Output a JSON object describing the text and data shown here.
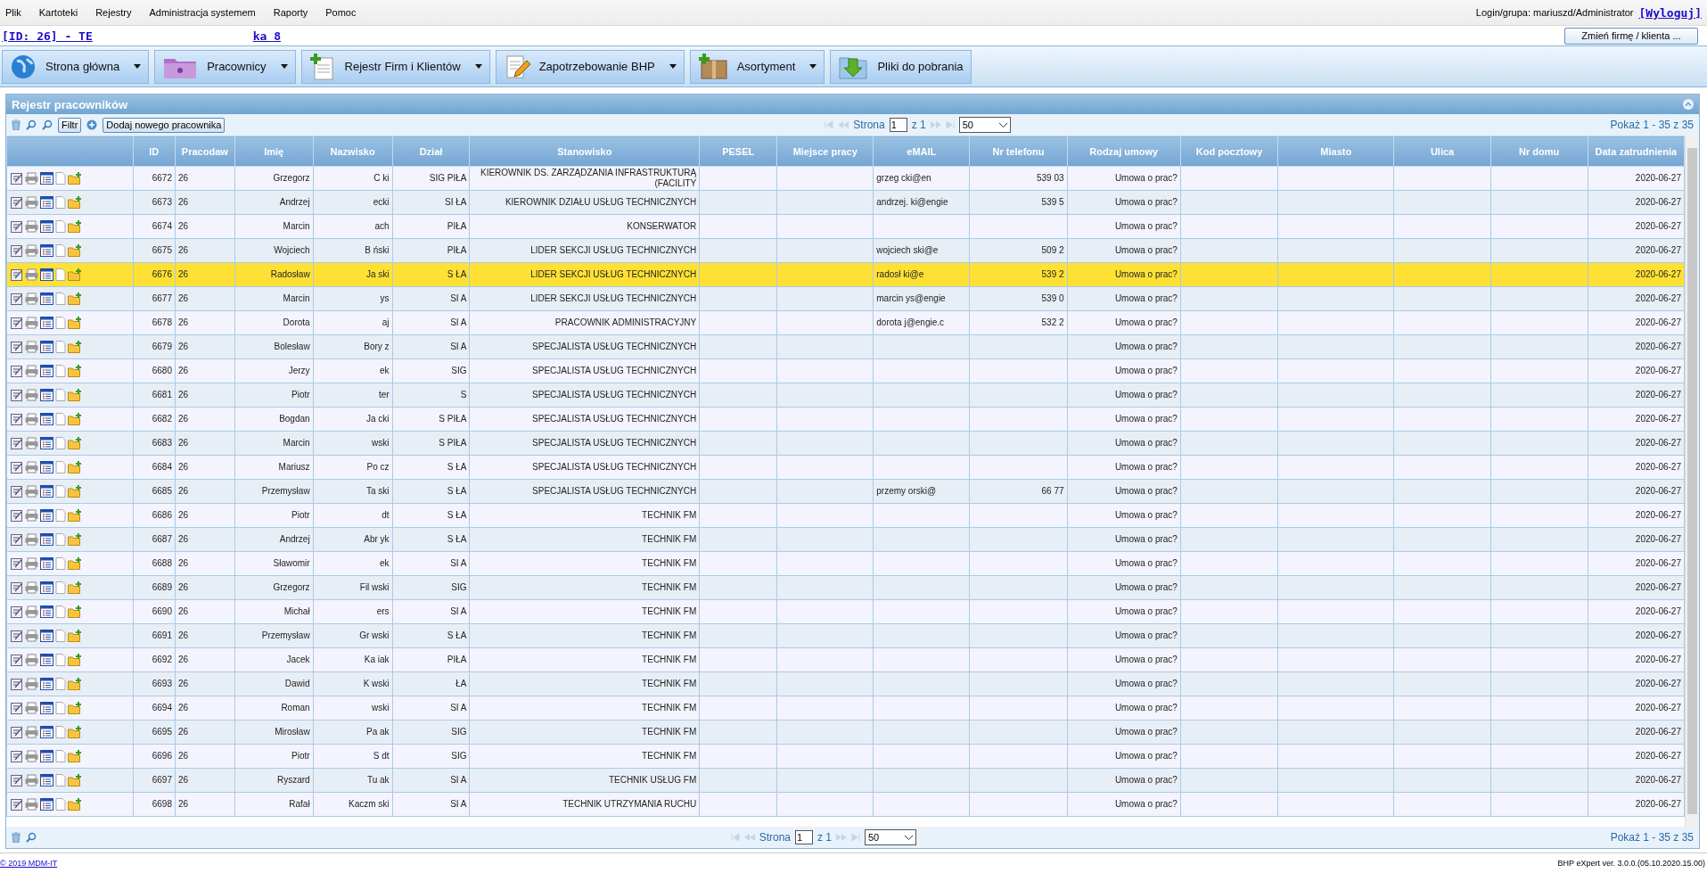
{
  "menu": [
    "Plik",
    "Kartoteki",
    "Rejestry",
    "Administracja systemem",
    "Raporty",
    "Pomoc"
  ],
  "login": {
    "label": "Login/grupa: mariuszd/Administrator",
    "logout": "[Wyloguj]"
  },
  "company_link": {
    "start": "[ID: 26] - TE",
    "end": "ka 8"
  },
  "change_company_button": "Zmień firmę / klienta ...",
  "toolbar": [
    {
      "label": "Strona główna",
      "kind": "globe",
      "has_menu": true
    },
    {
      "label": "Pracownicy",
      "kind": "folder",
      "has_menu": true
    },
    {
      "label": "Rejestr Firm i Klientów",
      "kind": "document",
      "has_menu": true
    },
    {
      "label": "Zapotrzebowanie BHP",
      "kind": "pencil",
      "has_menu": true
    },
    {
      "label": "Asortyment",
      "kind": "box",
      "has_menu": true
    },
    {
      "label": "Pliki do pobrania",
      "kind": "download",
      "has_menu": false
    }
  ],
  "panel": {
    "title": "Rejestr pracowników",
    "filter_button": "Filtr",
    "add_button": "Dodaj nowego pracownika",
    "pager_top": {
      "page_label": "Strona",
      "page": "1",
      "of": "z 1",
      "page_size": "50",
      "summary": "Pokaż 1 - 35 z 35"
    },
    "pager_bottom": {
      "page_label": "Strona",
      "page": "1",
      "of": "z 1",
      "page_size": "50",
      "summary": "Pokaż 1 - 35 z 35"
    }
  },
  "table": {
    "columns": [
      "ID",
      "Pracodaw",
      "Imię",
      "Nazwisko",
      "Dział",
      "Stanowisko",
      "PESEL",
      "Miejsce pracy",
      "eMAIL",
      "Nr telefonu",
      "Rodzaj umowy",
      "Kod pocztowy",
      "Miasto",
      "Ulica",
      "Nr domu",
      "Data zatrudnienia"
    ],
    "rows": [
      {
        "id": "6672",
        "employer": "26",
        "first_name": "Grzegorz",
        "last_name": "C ki",
        "department": "SIG PIŁA",
        "position": "KIEROWNIK DS. ZARZĄDZANIA INFRASTRUKTURĄ (FACILITY",
        "email": "grzeg cki@en",
        "phone": "539 03",
        "contract": "Umowa o prac?",
        "hire_date": "2020-06-27",
        "selected": false
      },
      {
        "id": "6673",
        "employer": "26",
        "first_name": "Andrzej",
        "last_name": "ecki",
        "department": "SI ŁA",
        "position": "KIEROWNIK DZIAŁU USŁUG TECHNICZNYCH",
        "email": "andrzej. ki@engie",
        "phone": "539 5",
        "contract": "Umowa o prac?",
        "hire_date": "2020-06-27",
        "selected": false
      },
      {
        "id": "6674",
        "employer": "26",
        "first_name": "Marcin",
        "last_name": "ach",
        "department": "PIŁA",
        "position": "KONSERWATOR",
        "contract": "Umowa o prac?",
        "hire_date": "2020-06-27",
        "selected": false
      },
      {
        "id": "6675",
        "employer": "26",
        "first_name": "Wojciech",
        "last_name": "B ński",
        "department": "PIŁA",
        "position": "LIDER SEKCJI USŁUG TECHNICZNYCH",
        "email": "wojciech ski@e",
        "phone": "509 2",
        "contract": "Umowa o prac?",
        "hire_date": "2020-06-27",
        "selected": false
      },
      {
        "id": "6676",
        "employer": "26",
        "first_name": "Radosław",
        "last_name": "Ja ski",
        "department": "S ŁA",
        "position": "LIDER SEKCJI USŁUG TECHNICZNYCH",
        "email": "radosł ki@e",
        "phone": "539 2",
        "contract": "Umowa o prac?",
        "hire_date": "2020-06-27",
        "selected": true
      },
      {
        "id": "6677",
        "employer": "26",
        "first_name": "Marcin",
        "last_name": "ys",
        "department": "SI A",
        "position": "LIDER SEKCJI USŁUG TECHNICZNYCH",
        "email": "marcin ys@engie",
        "phone": "539 0",
        "contract": "Umowa o prac?",
        "hire_date": "2020-06-27",
        "selected": false
      },
      {
        "id": "6678",
        "employer": "26",
        "first_name": "Dorota",
        "last_name": "aj",
        "department": "SI A",
        "position": "PRACOWNIK ADMINISTRACYJNY",
        "email": "dorota j@engie.c",
        "phone": "532 2",
        "contract": "Umowa o prac?",
        "hire_date": "2020-06-27",
        "selected": false
      },
      {
        "id": "6679",
        "employer": "26",
        "first_name": "Bolesław",
        "last_name": "Bory z",
        "department": "SI A",
        "position": "SPECJALISTA USŁUG TECHNICZNYCH",
        "contract": "Umowa o prac?",
        "hire_date": "2020-06-27",
        "selected": false
      },
      {
        "id": "6680",
        "employer": "26",
        "first_name": "Jerzy",
        "last_name": "ek",
        "department": "SIG",
        "position": "SPECJALISTA USŁUG TECHNICZNYCH",
        "contract": "Umowa o prac?",
        "hire_date": "2020-06-27",
        "selected": false
      },
      {
        "id": "6681",
        "employer": "26",
        "first_name": "Piotr",
        "last_name": "ter",
        "department": "S",
        "position": "SPECJALISTA USŁUG TECHNICZNYCH",
        "contract": "Umowa o prac?",
        "hire_date": "2020-06-27",
        "selected": false
      },
      {
        "id": "6682",
        "employer": "26",
        "first_name": "Bogdan",
        "last_name": "Ja cki",
        "department": "S PIŁA",
        "position": "SPECJALISTA USŁUG TECHNICZNYCH",
        "contract": "Umowa o prac?",
        "hire_date": "2020-06-27",
        "selected": false
      },
      {
        "id": "6683",
        "employer": "26",
        "first_name": "Marcin",
        "last_name": "wski",
        "department": "S PIŁA",
        "position": "SPECJALISTA USŁUG TECHNICZNYCH",
        "contract": "Umowa o prac?",
        "hire_date": "2020-06-27",
        "selected": false
      },
      {
        "id": "6684",
        "employer": "26",
        "first_name": "Mariusz",
        "last_name": "Po cz",
        "department": "S ŁA",
        "position": "SPECJALISTA USŁUG TECHNICZNYCH",
        "contract": "Umowa o prac?",
        "hire_date": "2020-06-27",
        "selected": false
      },
      {
        "id": "6685",
        "employer": "26",
        "first_name": "Przemysław",
        "last_name": "Ta ski",
        "department": "S ŁA",
        "position": "SPECJALISTA USŁUG TECHNICZNYCH",
        "email": "przemy orski@",
        "phone": "66 77",
        "contract": "Umowa o prac?",
        "hire_date": "2020-06-27",
        "selected": false
      },
      {
        "id": "6686",
        "employer": "26",
        "first_name": "Piotr",
        "last_name": "dt",
        "department": "S ŁA",
        "position": "TECHNIK FM",
        "contract": "Umowa o prac?",
        "hire_date": "2020-06-27",
        "selected": false
      },
      {
        "id": "6687",
        "employer": "26",
        "first_name": "Andrzej",
        "last_name": "Abr yk",
        "department": "S ŁA",
        "position": "TECHNIK FM",
        "contract": "Umowa o prac?",
        "hire_date": "2020-06-27",
        "selected": false
      },
      {
        "id": "6688",
        "employer": "26",
        "first_name": "Sławomir",
        "last_name": "ek",
        "department": "SI A",
        "position": "TECHNIK FM",
        "contract": "Umowa o prac?",
        "hire_date": "2020-06-27",
        "selected": false
      },
      {
        "id": "6689",
        "employer": "26",
        "first_name": "Grzegorz",
        "last_name": "Fil wski",
        "department": "SIG",
        "position": "TECHNIK FM",
        "contract": "Umowa o prac?",
        "hire_date": "2020-06-27",
        "selected": false
      },
      {
        "id": "6690",
        "employer": "26",
        "first_name": "Michał",
        "last_name": "ers",
        "department": "SI A",
        "position": "TECHNIK FM",
        "contract": "Umowa o prac?",
        "hire_date": "2020-06-27",
        "selected": false
      },
      {
        "id": "6691",
        "employer": "26",
        "first_name": "Przemysław",
        "last_name": "Gr wski",
        "department": "S ŁA",
        "position": "TECHNIK FM",
        "contract": "Umowa o prac?",
        "hire_date": "2020-06-27",
        "selected": false
      },
      {
        "id": "6692",
        "employer": "26",
        "first_name": "Jacek",
        "last_name": "Ka iak",
        "department": "PIŁA",
        "position": "TECHNIK FM",
        "contract": "Umowa o prac?",
        "hire_date": "2020-06-27",
        "selected": false
      },
      {
        "id": "6693",
        "employer": "26",
        "first_name": "Dawid",
        "last_name": "K wski",
        "department": "ŁA",
        "position": "TECHNIK FM",
        "contract": "Umowa o prac?",
        "hire_date": "2020-06-27",
        "selected": false
      },
      {
        "id": "6694",
        "employer": "26",
        "first_name": "Roman",
        "last_name": "wski",
        "department": "SI A",
        "position": "TECHNIK FM",
        "contract": "Umowa o prac?",
        "hire_date": "2020-06-27",
        "selected": false
      },
      {
        "id": "6695",
        "employer": "26",
        "first_name": "Mirosław",
        "last_name": "Pa ak",
        "department": "SIG",
        "position": "TECHNIK FM",
        "contract": "Umowa o prac?",
        "hire_date": "2020-06-27",
        "selected": false
      },
      {
        "id": "6696",
        "employer": "26",
        "first_name": "Piotr",
        "last_name": "S dt",
        "department": "SIG",
        "position": "TECHNIK FM",
        "contract": "Umowa o prac?",
        "hire_date": "2020-06-27",
        "selected": false
      },
      {
        "id": "6697",
        "employer": "26",
        "first_name": "Ryszard",
        "last_name": "Tu ak",
        "department": "SI A",
        "position": "TECHNIK USŁUG FM",
        "contract": "Umowa o prac?",
        "hire_date": "2020-06-27",
        "selected": false
      },
      {
        "id": "6698",
        "employer": "26",
        "first_name": "Rafał",
        "last_name": "Kaczm ski",
        "department": "SI A",
        "position": "TECHNIK UTRZYMANIA RUCHU",
        "contract": "Umowa o prac?",
        "hire_date": "2020-06-27",
        "selected": false
      }
    ]
  },
  "footer": {
    "copyright": "© 2019 MDM-IT",
    "version": "BHP eXpert ver. 3.0.0.(05.10.2020.15.00)"
  }
}
